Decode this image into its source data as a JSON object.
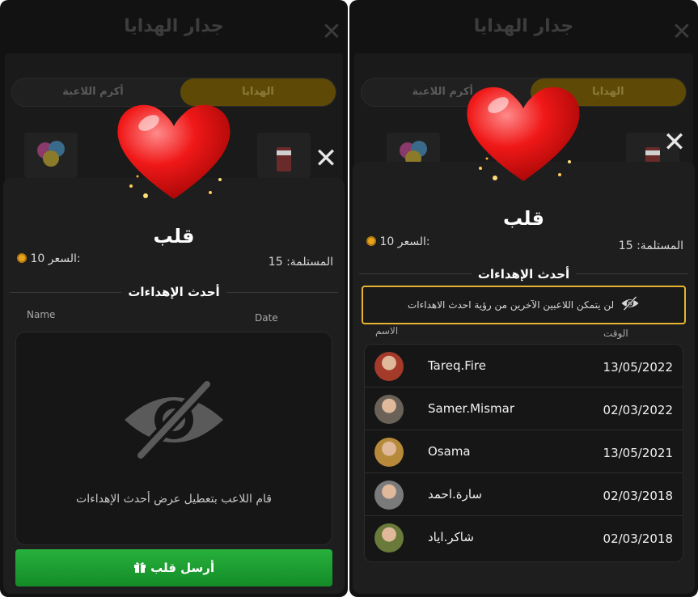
{
  "header": {
    "title": "جدار الهدايا"
  },
  "tabs": {
    "gifts": "الهدايا",
    "top_player": "أكرم اللاعبة"
  },
  "gift": {
    "name": "قلب",
    "received_label": "المستلمة:",
    "received_value": "15",
    "price_label": "السعر:",
    "price_value": "10"
  },
  "recent": {
    "title": "أحدث الإهداءات",
    "left_col_name": "Name",
    "left_col_date": "Date",
    "right_col_name": "الاسم",
    "right_col_time": "الوقت",
    "disabled_message": "قام اللاعب بتعطيل عرض أحدث الإهداءات",
    "privacy_banner": "لن يتمكن اللاعبين الآخرين من رؤية احدث الاهداءات",
    "rows": [
      {
        "name": "Tareq.Fire",
        "date": "13/05/2022",
        "avatar_color": "#a33a2a"
      },
      {
        "name": "Samer.Mismar",
        "date": "02/03/2022",
        "avatar_color": "#6a6258"
      },
      {
        "name": "Osama",
        "date": "13/05/2021",
        "avatar_color": "#b68a3a"
      },
      {
        "name": "سارة.احمد",
        "date": "02/03/2018",
        "avatar_color": "#7a7a7a"
      },
      {
        "name": "شاكر.اياد",
        "date": "02/03/2018",
        "avatar_color": "#6a7a3a"
      }
    ]
  },
  "send_button": {
    "label": "أرسل قلب"
  },
  "icons": {
    "close": "close-icon",
    "coin": "coin-icon",
    "eye_off": "eye-off-icon",
    "gift": "gift-icon",
    "heart": "heart-icon"
  },
  "colors": {
    "accent_gold": "#e9b32f",
    "send_green": "#1f9e32",
    "background": "#121212"
  }
}
